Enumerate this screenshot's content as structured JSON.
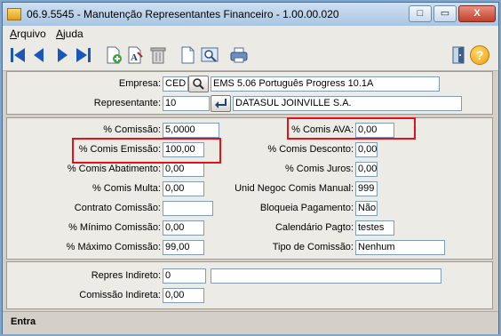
{
  "window": {
    "title": "06.9.5545 - Manutenção Representantes Financeiro - 1.00.00.020"
  },
  "titlebar_buttons": {
    "minimize": "□",
    "maximize": "▭",
    "close": "X"
  },
  "menu": {
    "items": [
      {
        "label": "Arquivo",
        "mnemonic": "A"
      },
      {
        "label": "Ajuda",
        "mnemonic": "A"
      }
    ]
  },
  "toolbar": {
    "icons": [
      "first-record-icon",
      "previous-record-icon",
      "next-record-icon",
      "last-record-icon",
      "new-document-icon",
      "text-edit-icon",
      "delete-icon",
      "blank-document-icon",
      "search-document-icon",
      "print-icon",
      "exit-icon",
      "help-icon"
    ],
    "help_label": "?"
  },
  "header": {
    "empresa_label": "Empresa:",
    "empresa_code": "CED",
    "empresa_name": "EMS 5.06 Português Progress 10.1A",
    "representante_label": "Representante:",
    "representante_code": "10",
    "representante_name": "DATASUL JOINVILLE S.A."
  },
  "commission": {
    "comissao_label": "% Comissão:",
    "comissao": "5,0000",
    "comis_emissao_label": "% Comis Emissão:",
    "comis_emissao": "100,00",
    "comis_abatimento_label": "% Comis Abatimento:",
    "comis_abatimento": "0,00",
    "comis_multa_label": "% Comis Multa:",
    "comis_multa": "0,00",
    "contrato_label": "Contrato Comissão:",
    "contrato": "",
    "minimo_label": "% Mínimo Comissão:",
    "minimo": "0,00",
    "maximo_label": "% Máximo Comissão:",
    "maximo": "99,00",
    "comis_ava_label": "% Comis AVA:",
    "comis_ava": "0,00",
    "comis_desconto_label": "% Comis Desconto:",
    "comis_desconto": "0,00",
    "comis_juros_label": "% Comis Juros:",
    "comis_juros": "0,00",
    "unid_negoc_label": "Unid Negoc Comis Manual:",
    "unid_negoc": "999",
    "bloqueia_label": "Bloqueia Pagamento:",
    "bloqueia": "Não",
    "calendario_label": "Calendário Pagto:",
    "calendario": "testes",
    "tipo_label": "Tipo de Comissão:",
    "tipo": "Nenhum"
  },
  "indirect": {
    "repres_indireto_label": "Repres Indireto:",
    "repres_indireto": "0",
    "repres_indireto_name": "",
    "comissao_indireta_label": "Comissão Indireta:",
    "comissao_indireta": "0,00"
  },
  "status": {
    "text": "Entra"
  },
  "colors": {
    "highlight_box": "#e0121b",
    "window_frame": "#4a6f93",
    "field_border": "#7f9db9"
  }
}
